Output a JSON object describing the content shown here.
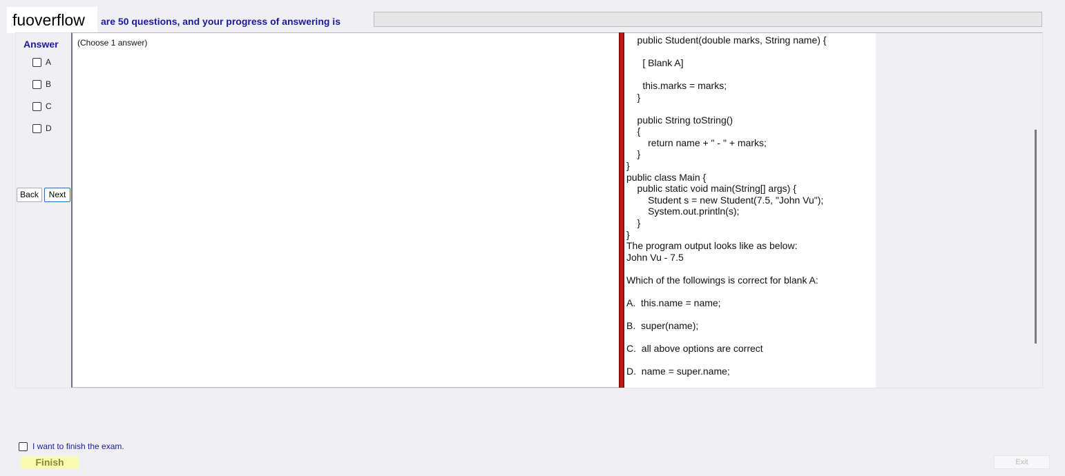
{
  "header": {
    "logo_text": "fuoverflow",
    "progress_text": "are 50 questions, and your progress of answering is",
    "progress_value": 0
  },
  "answer": {
    "title": "Answer",
    "options": [
      "A",
      "B",
      "C",
      "D"
    ],
    "choose_hint": "(Choose 1 answer)"
  },
  "nav": {
    "back_label": "Back",
    "next_label": "Next"
  },
  "question": {
    "lines": [
      "    public Student(double marks, String name) {",
      "",
      "      [ Blank A]",
      "",
      "      this.marks = marks;",
      "    }",
      "",
      "    public String toString()",
      "    {",
      "        return name + \" - \" + marks;",
      "    }",
      "}",
      "public class Main {",
      "    public static void main(String[] args) {",
      "        Student s = new Student(7.5, \"John Vu\");",
      "        System.out.println(s);",
      "    }",
      "}",
      "The program output looks like as below:",
      "John Vu - 7.5",
      "",
      "Which of the followings is correct for blank A:",
      "",
      "A.  this.name = name;",
      "",
      "B.  super(name);",
      "",
      "C.  all above options are correct",
      "",
      "D.  name = super.name;"
    ]
  },
  "footer": {
    "finish_check_label": "I want to finish the exam.",
    "finish_label": "Finish",
    "exit_label": "Exit"
  }
}
